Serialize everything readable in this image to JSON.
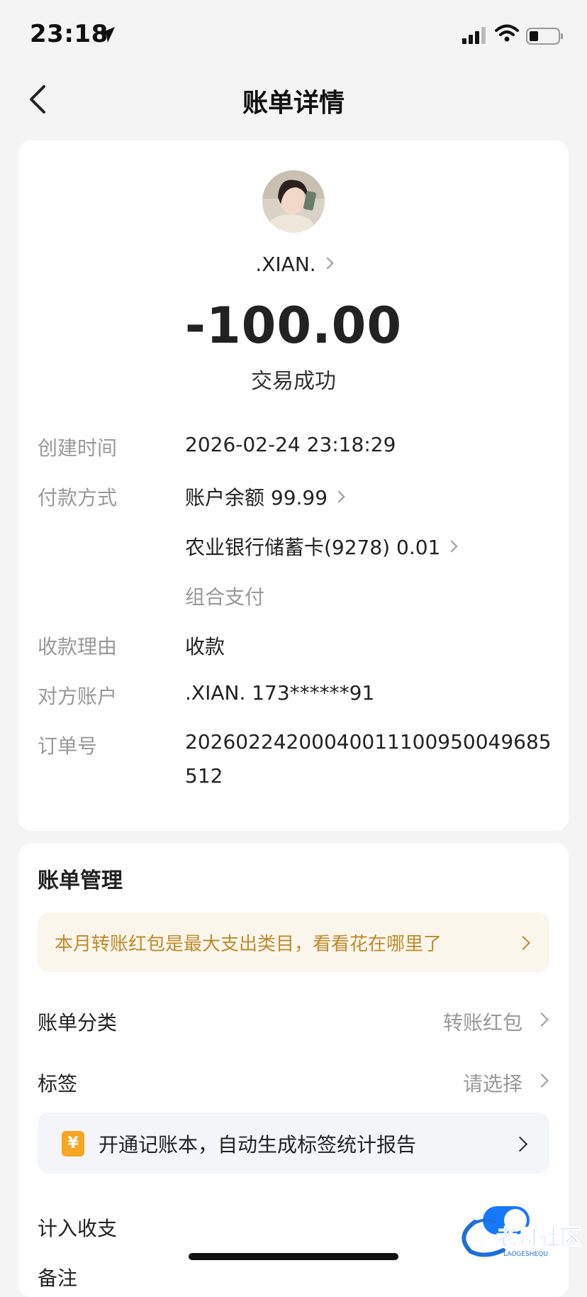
{
  "status_bar": {
    "time": "23:18"
  },
  "nav": {
    "title": "账单详情"
  },
  "payee": {
    "name": ".XIAN."
  },
  "amount": "-100.00",
  "status": "交易成功",
  "details": {
    "created_label": "创建时间",
    "created_value": "2026-02-24 23:18:29",
    "payment_label": "付款方式",
    "payment_1": "账户余额 99.99",
    "payment_2": "农业银行储蓄卡(9278) 0.01",
    "payment_3": "组合支付",
    "reason_label": "收款理由",
    "reason_value": "收款",
    "account_label": "对方账户",
    "account_value": ".XIAN. 173******91",
    "order_label": "订单号",
    "order_value": "20260224200040011100950049685512"
  },
  "management": {
    "title": "账单管理",
    "tip": "本月转账红包是最大支出类目，看看花在哪里了",
    "category_label": "账单分类",
    "category_value": "转账红包",
    "tag_label": "标签",
    "tag_value": "请选择",
    "promo_icon": "¥",
    "promo_text": "开通记账本，自动生成标签统计报告",
    "include_label": "计入收支",
    "include_on": true,
    "note_label": "备注"
  },
  "watermark": {
    "text": "老哥社区",
    "sub": "LAOGESHEQU"
  },
  "colors": {
    "accent": "#1677ff",
    "tip_text": "#c08a2c",
    "tip_bg": "#fbf6ec",
    "promo_icon": "#f5a623"
  }
}
